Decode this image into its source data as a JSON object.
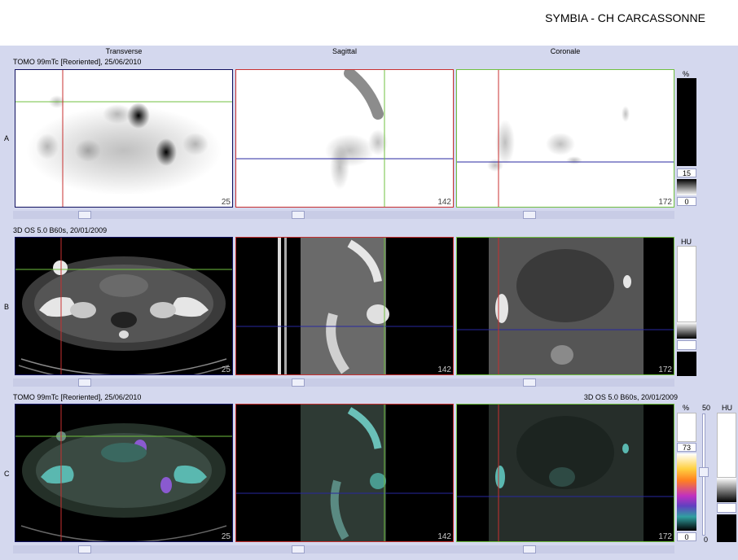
{
  "header": {
    "site": "SYMBIA - CH CARCASSONNE"
  },
  "columns": {
    "transverse": "Transverse",
    "sagittal": "Sagittal",
    "coronal": "Coronale"
  },
  "rows": {
    "a": {
      "letter": "A",
      "series": "TOMO 99mTc [Reoriented], 25/06/2010",
      "slices": [
        "25",
        "142",
        "172"
      ]
    },
    "b": {
      "letter": "B",
      "series": "3D  OS  5.0  B60s, 20/01/2009",
      "slices": [
        "25",
        "142",
        "172"
      ]
    },
    "c": {
      "letter": "C",
      "series_left": "TOMO 99mTc [Reoriented], 25/06/2010",
      "series_right": "3D  OS  5.0  B60s, 20/01/2009",
      "slices": [
        "25",
        "142",
        "172"
      ]
    }
  },
  "scales": {
    "a": {
      "unit": "%",
      "value": "15",
      "min": "0"
    },
    "b": {
      "unit": "HU"
    },
    "c": {
      "unit_pct": "%",
      "value": "73",
      "min": "0",
      "mid_top": "50",
      "mid_bottom": "0",
      "unit_hu": "HU"
    }
  },
  "colors": {
    "background": "#d4d8ee",
    "frame_red": "#c83030",
    "frame_green": "#70c040",
    "frame_navy": "#101060",
    "crosshair_blue": "#2828a0"
  }
}
